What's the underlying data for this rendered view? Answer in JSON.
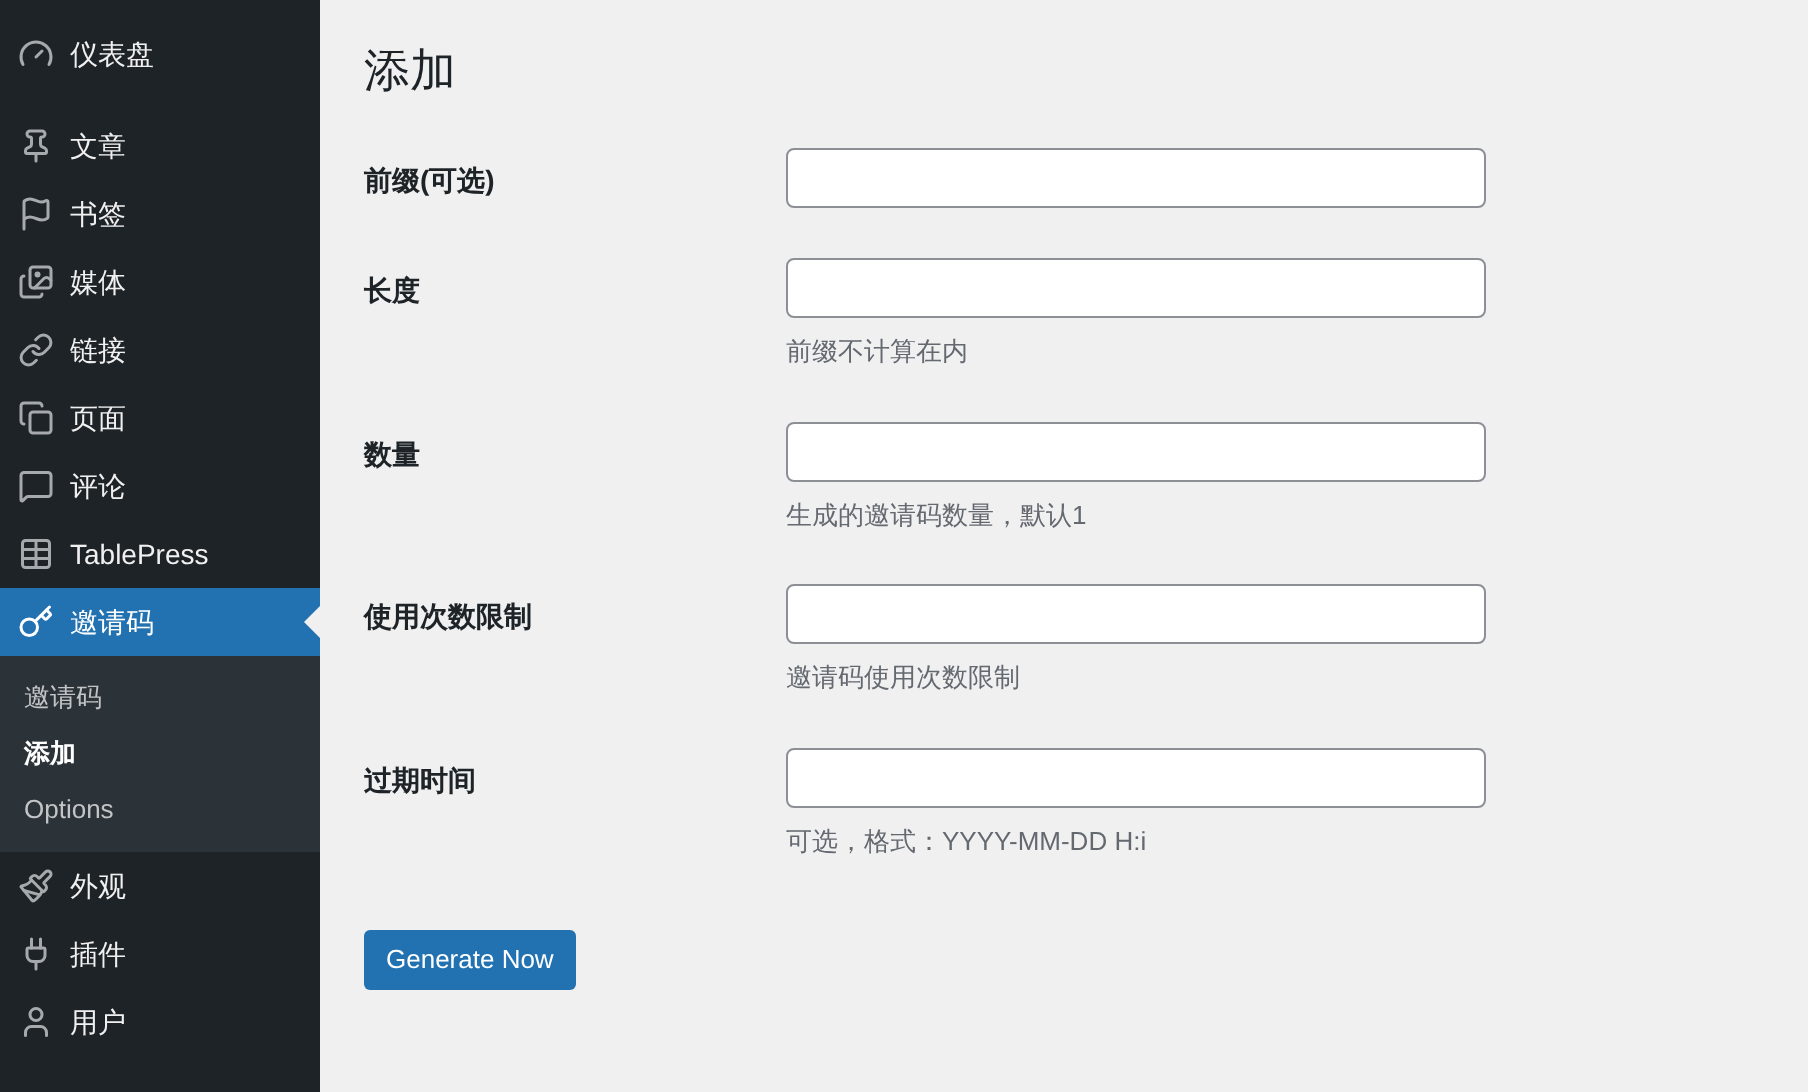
{
  "sidebar": {
    "items": [
      {
        "label": "仪表盘",
        "selected": false
      },
      {
        "label": "文章",
        "selected": false
      },
      {
        "label": "书签",
        "selected": false
      },
      {
        "label": "媒体",
        "selected": false
      },
      {
        "label": "链接",
        "selected": false
      },
      {
        "label": "页面",
        "selected": false
      },
      {
        "label": "评论",
        "selected": false
      },
      {
        "label": "TablePress",
        "selected": false
      },
      {
        "label": "邀请码",
        "selected": true,
        "submenu": [
          {
            "label": "邀请码",
            "selected": false
          },
          {
            "label": "添加",
            "selected": true
          },
          {
            "label": "Options",
            "selected": false
          }
        ]
      },
      {
        "label": "外观",
        "selected": false
      },
      {
        "label": "插件",
        "selected": false
      },
      {
        "label": "用户",
        "selected": false
      }
    ]
  },
  "page": {
    "title": "添加",
    "fields": [
      {
        "label": "前缀(可选)"
      },
      {
        "label": "长度",
        "help": "前缀不计算在内"
      },
      {
        "label": "数量",
        "help": "生成的邀请码数量，默认1"
      },
      {
        "label": "使用次数限制",
        "help": "邀请码使用次数限制"
      },
      {
        "label": "过期时间",
        "help": "可选，格式：YYYY-MM-DD H:i"
      }
    ],
    "button": "Generate Now"
  }
}
